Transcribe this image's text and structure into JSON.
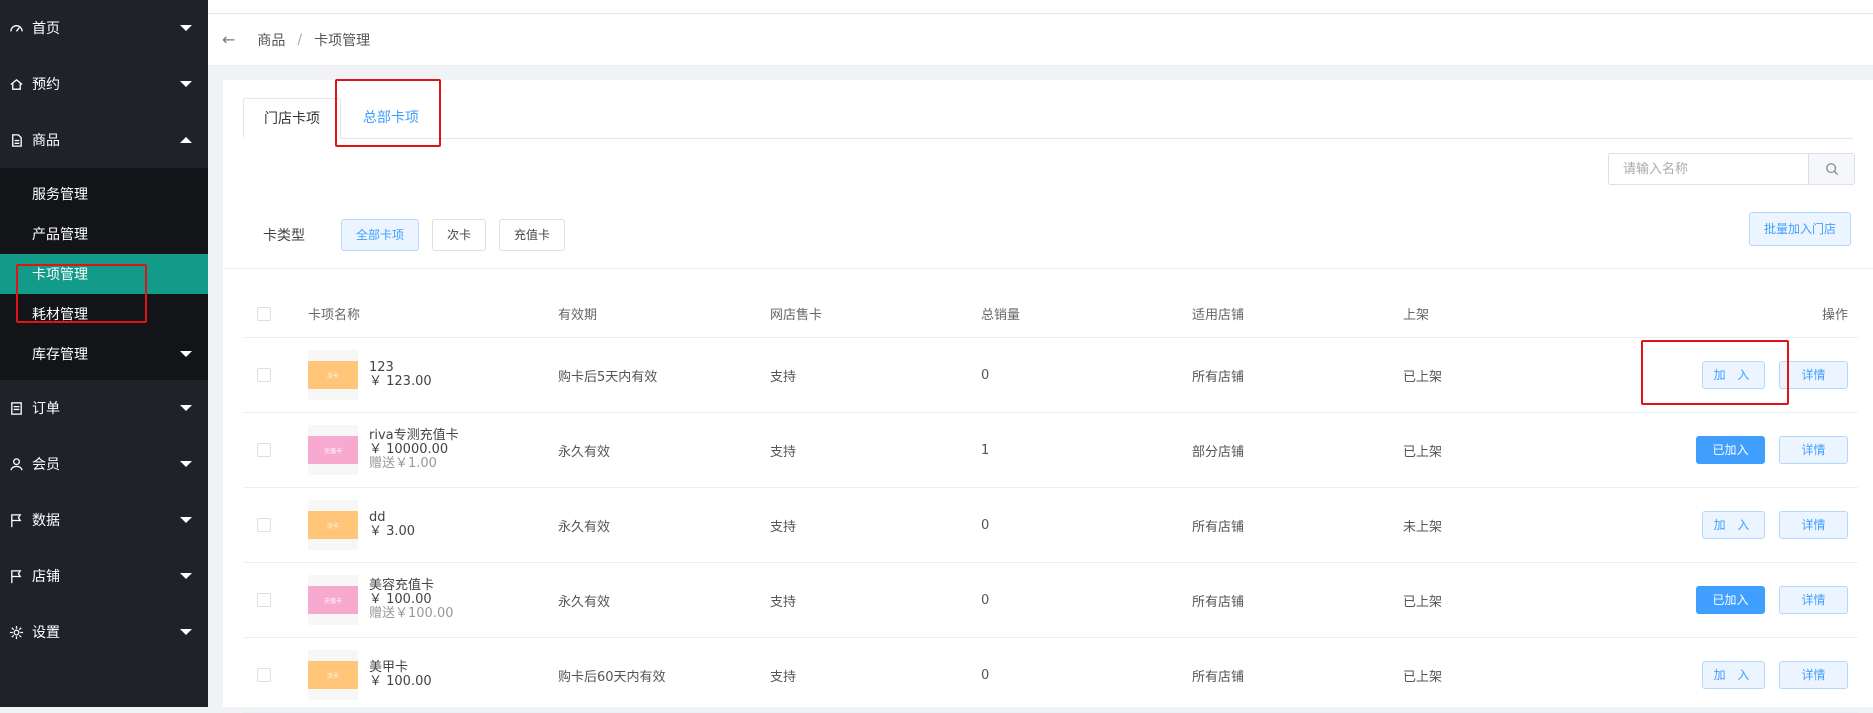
{
  "sidebar": {
    "items": [
      {
        "label": "首页",
        "icon": "dashboard-icon"
      },
      {
        "label": "预约",
        "icon": "home-icon"
      },
      {
        "label": "商品",
        "icon": "document-icon"
      }
    ],
    "submenu": [
      "服务管理",
      "产品管理",
      "卡项管理",
      "耗材管理",
      "库存管理"
    ],
    "items_after": [
      {
        "label": "订单",
        "icon": "clipboard-icon"
      },
      {
        "label": "会员",
        "icon": "user-icon"
      },
      {
        "label": "数据",
        "icon": "flag-icon"
      },
      {
        "label": "店铺",
        "icon": "flag-icon"
      },
      {
        "label": "设置",
        "icon": "gear-icon"
      }
    ]
  },
  "breadcrumb": {
    "parent": "商品",
    "sep": "/",
    "current": "卡项管理"
  },
  "tabs": [
    "门店卡项",
    "总部卡项"
  ],
  "search": {
    "placeholder": "请输入名称"
  },
  "filter": {
    "label": "卡类型",
    "options": [
      "全部卡项",
      "次卡",
      "充值卡"
    ]
  },
  "batch_button": "批量加入门店",
  "table": {
    "headers": [
      "卡项名称",
      "有效期",
      "网店售卡",
      "总销量",
      "适用店铺",
      "上架",
      "操作"
    ],
    "rows": [
      {
        "name": "123",
        "price": "￥ 123.00",
        "gift": "",
        "thumb_text": "次卡",
        "validity": "购卡后5天内有效",
        "online": "支持",
        "sales": "0",
        "stores": "所有店铺",
        "status": "已上架",
        "action": "加 入",
        "detail": "详情"
      },
      {
        "name": "riva专测充值卡",
        "price": "￥ 10000.00",
        "gift": "赠送￥1.00",
        "thumb_text": "充值卡",
        "validity": "永久有效",
        "online": "支持",
        "sales": "1",
        "stores": "部分店铺",
        "status": "已上架",
        "action": "已加入",
        "detail": "详情"
      },
      {
        "name": "dd",
        "price": "￥ 3.00",
        "gift": "",
        "thumb_text": "次卡",
        "validity": "永久有效",
        "online": "支持",
        "sales": "0",
        "stores": "所有店铺",
        "status": "未上架",
        "action": "加 入",
        "detail": "详情"
      },
      {
        "name": "美容充值卡",
        "price": "￥ 100.00",
        "gift": "赠送￥100.00",
        "thumb_text": "充值卡",
        "validity": "永久有效",
        "online": "支持",
        "sales": "0",
        "stores": "所有店铺",
        "status": "已上架",
        "action": "已加入",
        "detail": "详情"
      },
      {
        "name": "美甲卡",
        "price": "￥ 100.00",
        "gift": "",
        "thumb_text": "次卡",
        "validity": "购卡后60天内有效",
        "online": "支持",
        "sales": "0",
        "stores": "所有店铺",
        "status": "已上架",
        "action": "加 入",
        "detail": "详情"
      }
    ]
  },
  "colors": {
    "sidebar_bg": "#1f2329",
    "active_menu": "#129b88",
    "primary": "#409eff",
    "highlight": "#e01414"
  }
}
